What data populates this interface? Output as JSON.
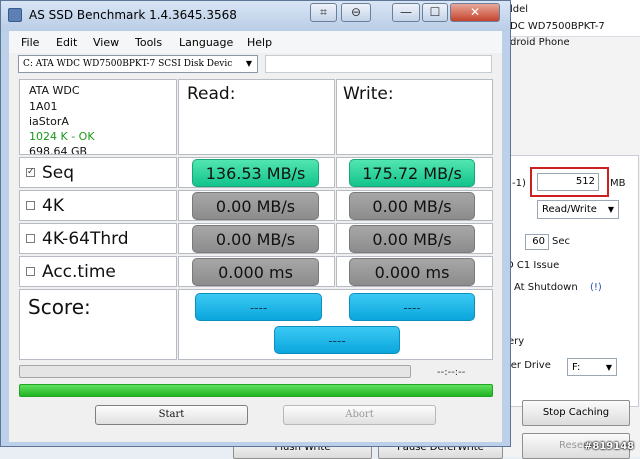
{
  "background_window": {
    "top_labels": [
      "ldel",
      "DC WD7500BPKT-7",
      "droid Phone"
    ],
    "size_label": "-1)",
    "size_value": "512",
    "size_unit": "MB",
    "mode_select": "Read/Write",
    "seconds_value": "60",
    "seconds_unit": "Sec",
    "c1_issue": "D C1 Issue",
    "at_shutdown": "At Shutdown",
    "help_mark": "(!)",
    "ery_label": "ery",
    "ier_drive_label": "ier Drive",
    "drive_value": "F:",
    "stop_caching": "Stop Caching",
    "reserve_partial": "Reserv",
    "flush_write": "Flush Write",
    "pause_defer": "Pause DeferWrite",
    "watermark": "#819148"
  },
  "window": {
    "title": "AS SSD Benchmark 1.4.3645.3568",
    "controls": [
      "⌗",
      "⊖",
      "—",
      "☐",
      "✕"
    ]
  },
  "menu": [
    "File",
    "Edit",
    "View",
    "Tools",
    "Language",
    "Help"
  ],
  "drive_select": "C: ATA WDC WD7500BPKT-7 SCSI Disk Devic",
  "drive_info": {
    "model": "ATA WDC",
    "firmware": "1A01",
    "driver": "iaStorA",
    "alignment": "1024 K - OK",
    "size": "698.64 GB"
  },
  "headers": {
    "read": "Read:",
    "write": "Write:"
  },
  "tests": [
    {
      "label": "Seq",
      "checked": true,
      "read": "136.53 MB/s",
      "write": "175.72 MB/s"
    },
    {
      "label": "4K",
      "checked": false,
      "read": "0.00 MB/s",
      "write": "0.00 MB/s"
    },
    {
      "label": "4K-64Thrd",
      "checked": false,
      "read": "0.00 MB/s",
      "write": "0.00 MB/s"
    },
    {
      "label": "Acc.time",
      "checked": false,
      "read": "0.000 ms",
      "write": "0.000 ms"
    }
  ],
  "score": {
    "label": "Score:",
    "read": "----",
    "write": "----",
    "total": "----"
  },
  "status": {
    "time": "--:--:--"
  },
  "buttons": {
    "start": "Start",
    "abort": "Abort"
  },
  "colors": {
    "seq_result": "#14c38c",
    "idle_result": "#8c8c8c",
    "score": "#0aa6dc",
    "progress": "#20b520"
  }
}
